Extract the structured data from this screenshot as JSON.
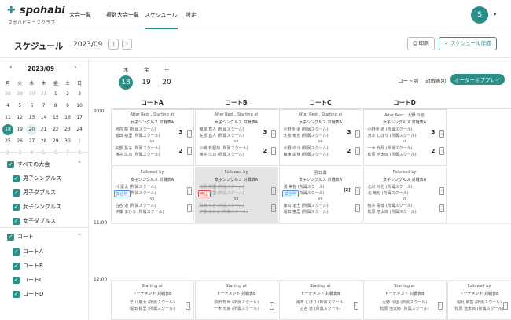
{
  "app": {
    "logo": "spohabi",
    "logo_sub": "スポハビテニスクラブ",
    "avatar": "S"
  },
  "nav": [
    "大会一覧",
    "複数大会一覧",
    "スケジュール",
    "設定"
  ],
  "header": {
    "title": "スケジュール",
    "month": "2023/09",
    "print": "印刷",
    "create": "スケジュール作成"
  },
  "calendar": {
    "title": "2023/09",
    "dow": [
      "月",
      "火",
      "水",
      "木",
      "金",
      "土",
      "日"
    ],
    "weeks": [
      [
        "28",
        "29",
        "30",
        "31",
        "1",
        "2",
        "3"
      ],
      [
        "4",
        "5",
        "6",
        "7",
        "8",
        "9",
        "10"
      ],
      [
        "11",
        "12",
        "13",
        "14",
        "15",
        "16",
        "17"
      ],
      [
        "18",
        "19",
        "20",
        "21",
        "22",
        "23",
        "24"
      ],
      [
        "25",
        "26",
        "27",
        "28",
        "29",
        "30",
        "1"
      ],
      [
        "2",
        "3",
        "4",
        "5",
        "6",
        "7",
        "8"
      ]
    ]
  },
  "filters": {
    "tournaments_label": "すべての大会",
    "tournaments": [
      "男子シングルス",
      "男子ダブルス",
      "女子シングルス",
      "女子ダブルス"
    ],
    "courts_label": "コート",
    "courts": [
      "コートA",
      "コートB",
      "コートC",
      "コートD"
    ]
  },
  "days": [
    {
      "dow": "木",
      "num": "18"
    },
    {
      "dow": "金",
      "num": "19"
    },
    {
      "dow": "土",
      "num": "20"
    }
  ],
  "views": [
    "コート別",
    "対戦表別",
    "オーダーオブプレイ"
  ],
  "times": [
    "9:00",
    "11:00",
    "12:00"
  ],
  "courts": [
    "コートA",
    "コートB",
    "コートC",
    "コートD"
  ],
  "cards": {
    "a1": {
      "h": "After Rest , Starting at",
      "t": "女子シングルス 対戦表A",
      "p1": "河内 藤 (所属スクール)",
      "p2": "堀田 樹里 (所属スクール)",
      "s1": "3",
      "p3": "矢部 葉子 (所属スクール)",
      "p4": "横井 広司 (所属スクール)",
      "s2": "2",
      "vs": "vs"
    },
    "b1": {
      "h": "After Rest , Starting at",
      "t": "女子シングルス 対戦表A",
      "p1": "槻岸 直人 (所属スクール)",
      "p2": "矢部 直人 (所属スクール)",
      "s1": "3",
      "p3": "小嶋 有起哉 (所属スクール)",
      "p4": "横井 洋司 (所属スクール)",
      "s2": "2",
      "vs": "vs"
    },
    "c1": {
      "h": "After Rest , Starting at",
      "t": "女子シングルス 対戦表A",
      "p1": "小野寺 道 (所属スクール)",
      "p2": "大熊 竜也 (所属スクール)",
      "s1": "3",
      "p3": "小野 ゆう (所属スクール)",
      "p4": "梅津 由芽 (所属スクール)",
      "s2": "2",
      "vs": "vs"
    },
    "d1": {
      "h": "After Rest , 大野 玲也",
      "t": "女子シングルス 対戦表A",
      "p1": "小野寺 道 (所属スクール)",
      "p2": "河本 しほり (所属スクール)",
      "s1": "3",
      "p3": "一木 光政 (所属スクール)",
      "p4": "松原 浩太郎 (所属スクール)",
      "s2": "2",
      "vs": "vs"
    },
    "a2": {
      "h": "Followed by",
      "t": "女子シングルス 対戦表A",
      "badge": "試合中",
      "p1": "川 慶太 (所属スクール)",
      "p2": "湯 竜也 (所属スクール)",
      "p3": "古谷 道 (所属スクール)",
      "p4": "伊藤 まひる (所属スクール)",
      "vs": "vs"
    },
    "b2": {
      "h": "Followed by",
      "t": "女子シングルス 対戦表A",
      "badge": "中止",
      "p1": "松原 樹里 (所属スクール)",
      "p2": "島田 樹里 (所属スクール)",
      "p3": "山田 みき (所属スクール)",
      "p4": "伊藤 まひる (所属スクール)",
      "vs": "vs"
    },
    "c2": {
      "h": "羽田 薫",
      "t": "女子シングルス 対戦表A",
      "badge": "試合中",
      "p1": "浅 美佐 (所属スクール)",
      "p2": "本 由宇 (所属スクール)",
      "s": "[2]",
      "p3": "篠山 道士 (所属スクール)",
      "p4": "堀田 樹里 (所属スクール)",
      "vs": "vs"
    },
    "d2": {
      "h": "Followed by",
      "t": "女子シングルス 対戦表A",
      "p1": "北川 玲也 (所属スクール)",
      "p2": "北 竜也 (所属スクール)",
      "p3": "板井 陽博 (所属スクール)",
      "p4": "松原 浩太郎 (所属スクール)",
      "vs": "vs"
    },
    "a3": {
      "h": "Starting at",
      "t": "トーナメント 対戦表B",
      "p1": "早川 慶太 (所属スクール)",
      "p2": "堀田 樹里 (所属スクール)"
    },
    "b3": {
      "h": "Starting at",
      "t": "トーナメント 対戦表B",
      "p1": "須田 知世 (所属スクール)",
      "p2": "一木 光良 (所属スクール)"
    },
    "c3": {
      "h": "Starting at",
      "t": "トーナメント 対戦表B",
      "p1": "河本 しほり (所属スクール)",
      "p2": "古谷 道 (所属スクール)"
    },
    "d3": {
      "h": "Starting at",
      "t": "トーナメント 対戦表B",
      "p1": "大野 玲也 (所属スクール)",
      "p2": "松原 浩太郎 (所属スクール)"
    },
    "e3": {
      "h": "Followed by",
      "t": "トーナメント 対戦表B",
      "p1": "堀北 助基 (所属スクール)",
      "p2": "松原 浩太郎 (所属スクール)"
    }
  }
}
